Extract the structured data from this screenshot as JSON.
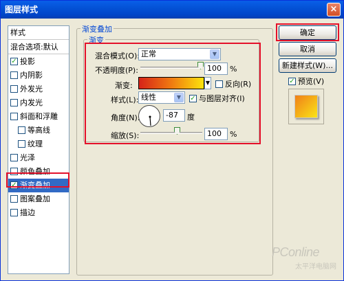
{
  "window": {
    "title": "图层样式",
    "close_glyph": "×"
  },
  "sidebar": {
    "header": "样式",
    "blend_default": "混合选项:默认",
    "items": [
      {
        "label": "投影",
        "checked": true
      },
      {
        "label": "内阴影",
        "checked": false
      },
      {
        "label": "外发光",
        "checked": false
      },
      {
        "label": "内发光",
        "checked": false
      },
      {
        "label": "斜面和浮雕",
        "checked": false
      },
      {
        "label": "等高线",
        "checked": false
      },
      {
        "label": "纹理",
        "checked": false
      },
      {
        "label": "光泽",
        "checked": false
      },
      {
        "label": "颜色叠加",
        "checked": false
      },
      {
        "label": "渐变叠加",
        "checked": true
      },
      {
        "label": "图案叠加",
        "checked": false
      },
      {
        "label": "描边",
        "checked": false
      }
    ]
  },
  "panel": {
    "section_title": "渐变叠加",
    "group_title": "渐变",
    "blend_mode_label": "混合模式(O):",
    "blend_mode_value": "正常",
    "opacity_label": "不透明度(P):",
    "opacity_value": "100",
    "opacity_unit": "%",
    "gradient_label": "渐变:",
    "reverse_label": "反向(R)",
    "reverse_checked": false,
    "style_label": "样式(L):",
    "style_value": "线性",
    "align_label": "与图层对齐(I)",
    "align_checked": true,
    "angle_label": "角度(N):",
    "angle_value": "-87",
    "angle_unit": "度",
    "scale_label": "缩放(S):",
    "scale_value": "100",
    "scale_unit": "%"
  },
  "buttons": {
    "ok": "确定",
    "cancel": "取消",
    "new_style": "新建样式(W)...",
    "preview_label": "预览(V)",
    "preview_checked": true
  },
  "watermark": {
    "logo": "PConline",
    "sub": "太平洋电脑网"
  },
  "colors": {
    "gradient_start": "#D62318",
    "gradient_end": "#FCE30C",
    "highlight": "#E4102A"
  }
}
